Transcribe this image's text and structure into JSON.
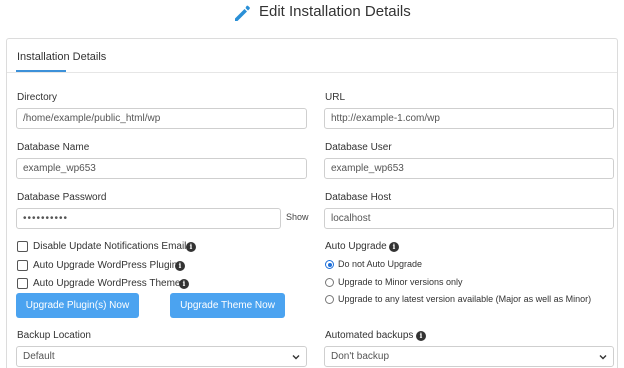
{
  "header": {
    "icon": "pencil-icon",
    "title": "Edit Installation Details",
    "icon_color": "#2a8fd6"
  },
  "card": {
    "tab_label": "Installation Details",
    "tab_accent": "#3d91d9"
  },
  "fields": {
    "directory": {
      "label": "Directory",
      "value": "/home/example/public_html/wp"
    },
    "url": {
      "label": "URL",
      "value": "http://example-1.com/wp"
    },
    "db_name": {
      "label": "Database Name",
      "value": "example_wp653"
    },
    "db_user": {
      "label": "Database User",
      "value": "example_wp653"
    },
    "db_password": {
      "label": "Database Password",
      "value": "••••••••••",
      "show_label": "Show"
    },
    "db_host": {
      "label": "Database Host",
      "value": "localhost"
    }
  },
  "checkboxes": [
    {
      "label": "Disable Update Notifications Emails",
      "checked": false
    },
    {
      "label": "Auto Upgrade WordPress Plugins",
      "checked": false
    },
    {
      "label": "Auto Upgrade WordPress Themes",
      "checked": false
    }
  ],
  "auto_upgrade": {
    "label": "Auto Upgrade",
    "options": [
      {
        "label": "Do not Auto Upgrade",
        "selected": true
      },
      {
        "label": "Upgrade to Minor versions only",
        "selected": false
      },
      {
        "label": "Upgrade to any latest version available (Major as well as Minor)",
        "selected": false
      }
    ]
  },
  "buttons": {
    "upgrade_plugins": "Upgrade Plugin(s) Now",
    "upgrade_theme": "Upgrade Theme Now",
    "button_color": "#4ba3f0"
  },
  "backup_location": {
    "label": "Backup Location",
    "selected": "Default"
  },
  "automated_backups": {
    "label": "Automated backups",
    "selected": "Don't backup"
  }
}
